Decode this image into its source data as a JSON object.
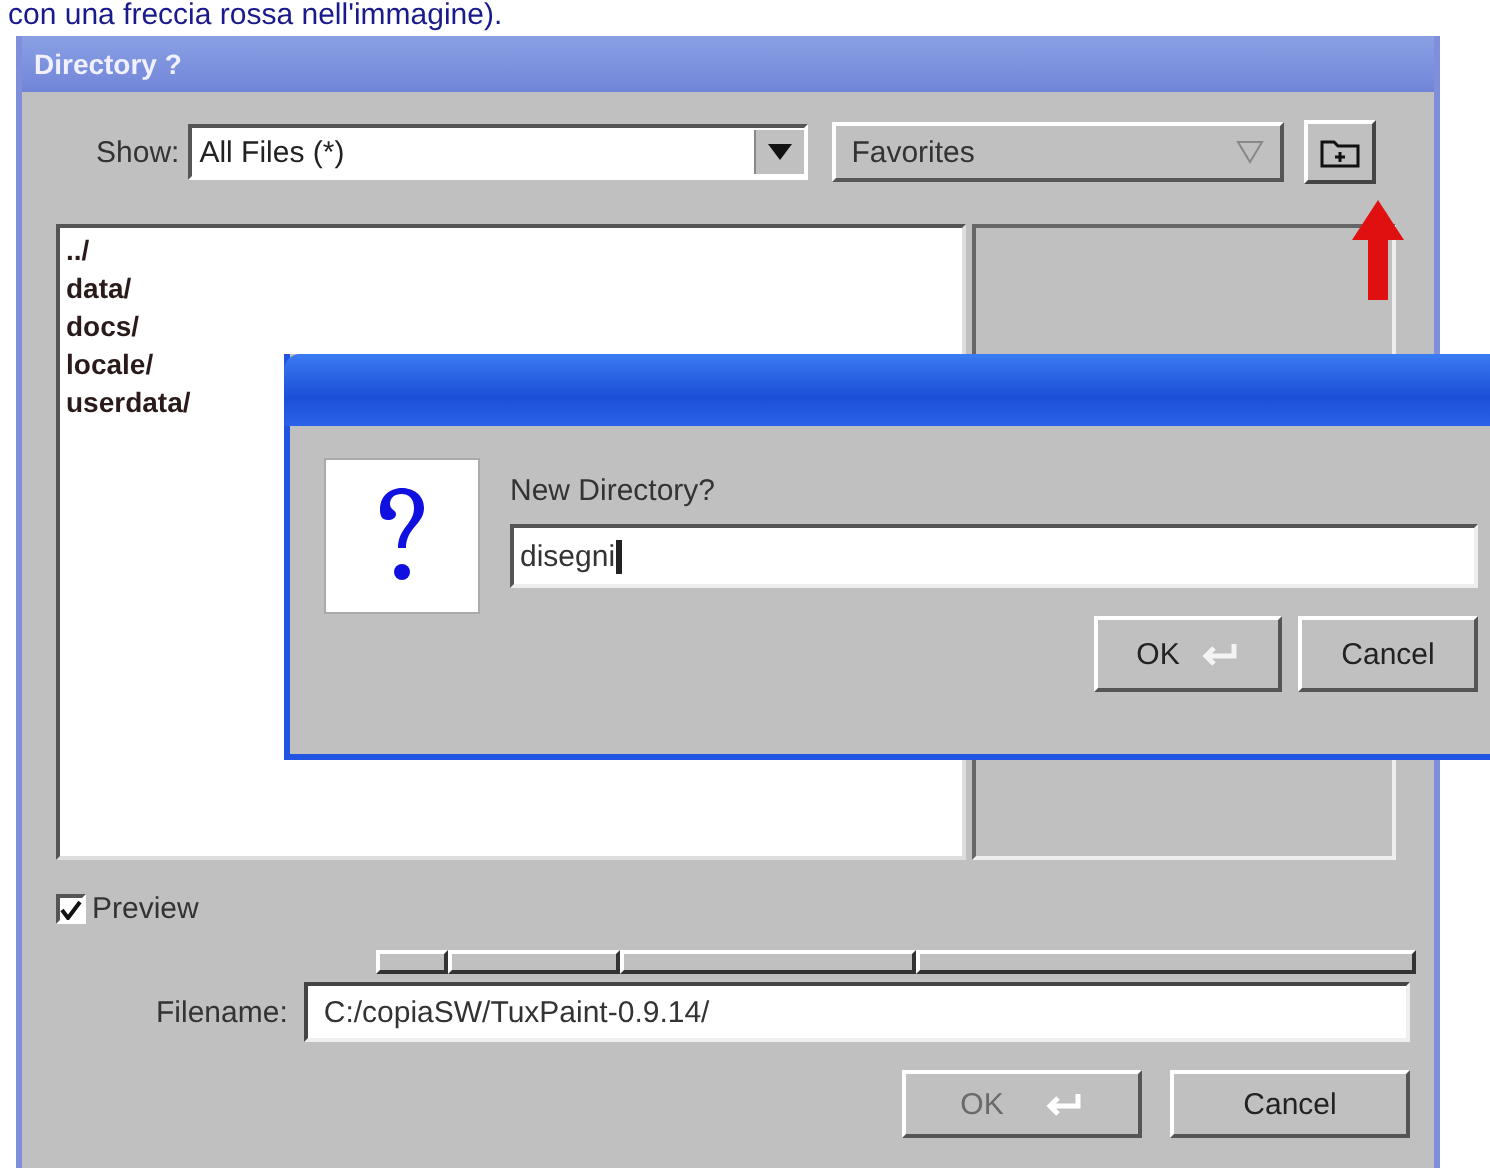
{
  "caption": "con una freccia rossa nell'immagine).",
  "window": {
    "title": "Directory ?"
  },
  "show": {
    "label": "Show:",
    "value": "All Files (*)"
  },
  "favorites": {
    "label": "Favorites"
  },
  "files": [
    "../",
    "data/",
    "docs/",
    "locale/",
    "userdata/"
  ],
  "preview": {
    "label": "Preview",
    "checked": true
  },
  "filename": {
    "label": "Filename:",
    "value": "C:/copiaSW/TuxPaint-0.9.14/"
  },
  "buttons": [
    {
      "label": "OK",
      "disabled": true,
      "enter": true
    },
    {
      "label": "Cancel",
      "disabled": false,
      "enter": false
    }
  ],
  "prompt": {
    "label": "New Directory?",
    "value": "disegni",
    "buttons": [
      {
        "label": "OK",
        "enter": true
      },
      {
        "label": "Cancel",
        "enter": false
      }
    ]
  }
}
